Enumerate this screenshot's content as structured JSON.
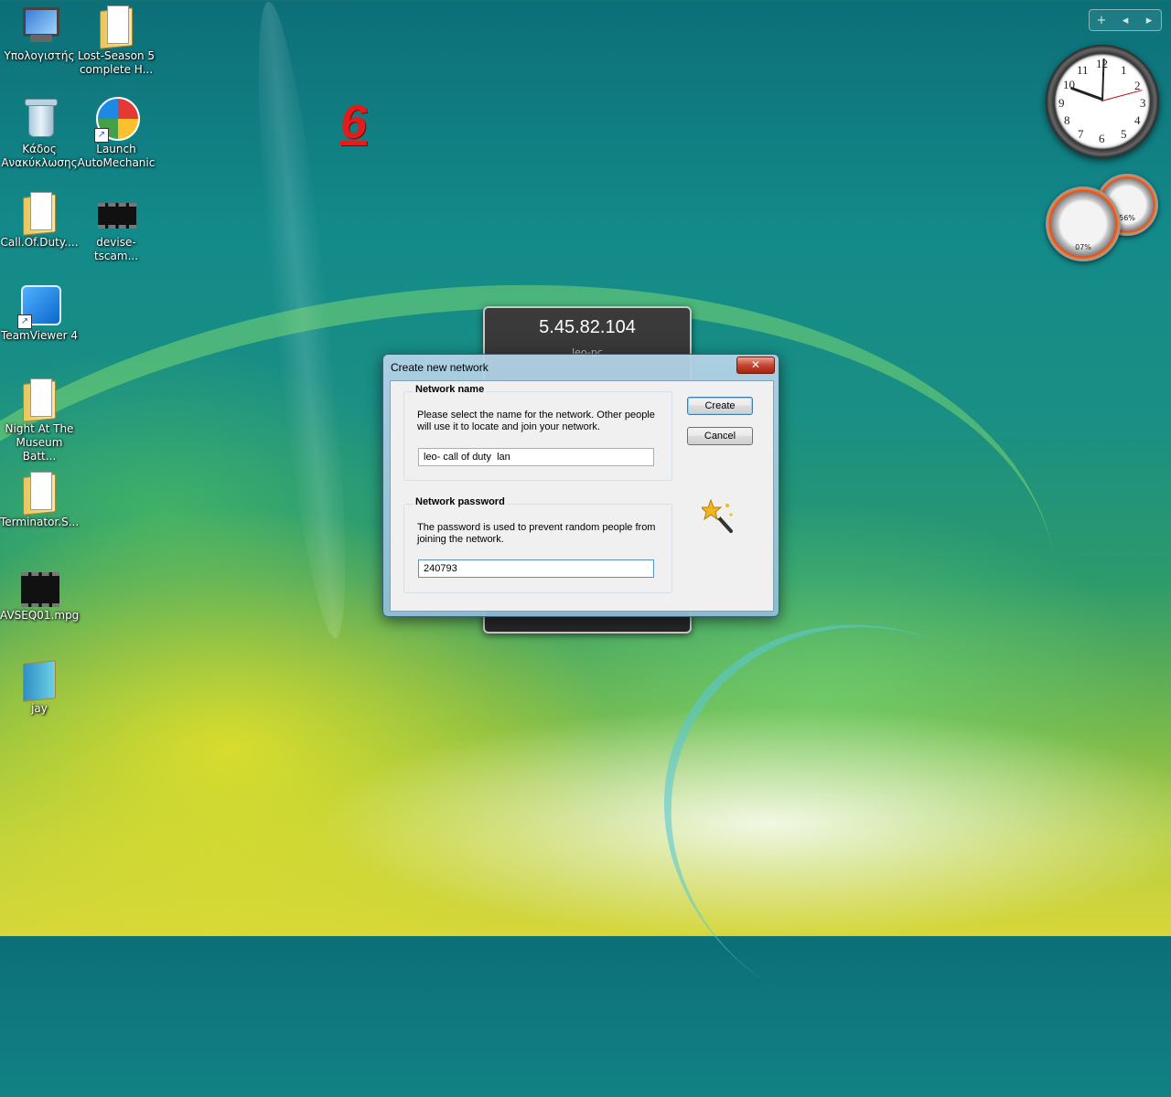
{
  "desktop": {
    "icons": [
      {
        "label": "Υπολογιστής",
        "icon": "computer-icon"
      },
      {
        "label": "Lost-Season 5 complete H...",
        "icon": "folder-icon"
      },
      {
        "label": "Κάδος Ανακύκλωσης",
        "icon": "recycle-bin-icon"
      },
      {
        "label": "Launch AutoMechanic",
        "icon": "automechanic-icon"
      },
      {
        "label": "Call.Of.Duty....",
        "icon": "folder-icon"
      },
      {
        "label": "devise-tscam...",
        "icon": "video-file-icon"
      },
      {
        "label": "TeamViewer 4",
        "icon": "teamviewer-icon"
      },
      {
        "label": "Night At The Museum Batt...",
        "icon": "folder-icon"
      },
      {
        "label": "Terminator.S...",
        "icon": "folder-icon"
      },
      {
        "label": "AVSEQ01.mpg",
        "icon": "video-file-icon"
      },
      {
        "label": "jay",
        "icon": "folder-icon"
      }
    ],
    "overlay_number": "6"
  },
  "sidebar_gadgets": {
    "toolbar": {
      "add": "+",
      "prev": "◂",
      "next": "▸"
    },
    "clock_numbers": [
      "12",
      "1",
      "2",
      "3",
      "4",
      "5",
      "6",
      "7",
      "8",
      "9",
      "10",
      "11"
    ],
    "cpu_meter": {
      "cpu": "07%",
      "memory": "56%"
    }
  },
  "ip_gadget": {
    "ip": "5.45.82.104",
    "host": "leo-pc"
  },
  "dialog": {
    "title": "Create new network",
    "close_label": "✕",
    "network_name": {
      "legend": "Network name",
      "description": "Please select the name for the network. Other people will use it to locate and join your network.",
      "value": "leo- call of duty  lan"
    },
    "network_password": {
      "legend": "Network password",
      "description": "The password is used to prevent random people from joining the network.",
      "value": "240793"
    },
    "create_label": "Create",
    "cancel_label": "Cancel"
  }
}
